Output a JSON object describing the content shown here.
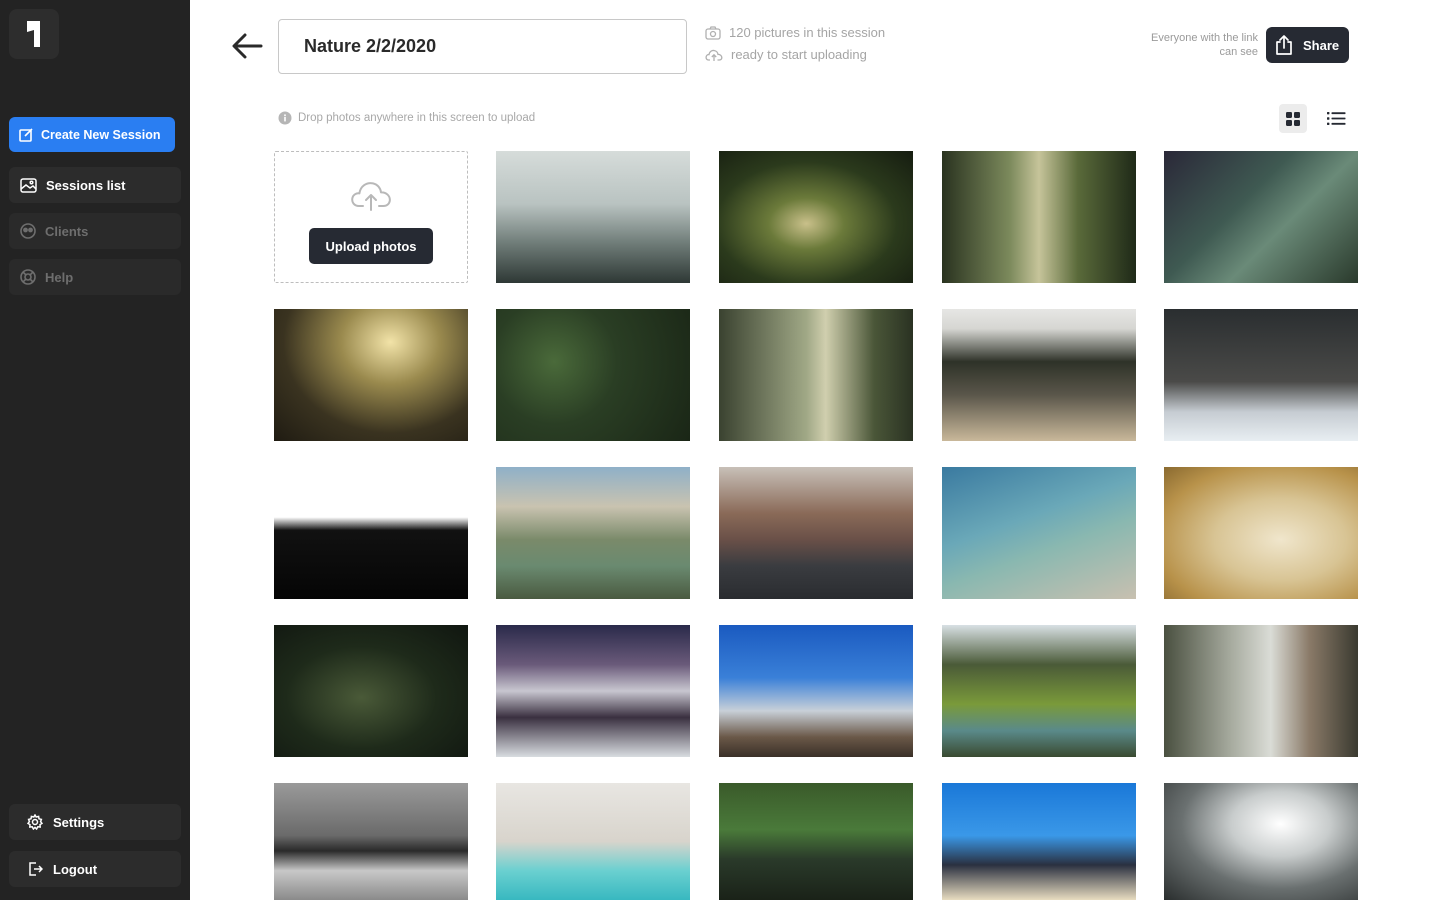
{
  "app": {
    "brand_colors": {
      "sidebar": "#232323",
      "primary": "#2a7ef2",
      "dark_button": "#262a33"
    }
  },
  "sidebar": {
    "logo_icon": "brand-logo-icon",
    "create_label": "Create New Session",
    "items": [
      {
        "label": "Sessions list",
        "icon": "photo-gallery-icon",
        "active": true
      },
      {
        "label": "Clients",
        "icon": "clients-icon",
        "active": false
      },
      {
        "label": "Help",
        "icon": "help-icon",
        "active": false
      }
    ],
    "bottom": [
      {
        "label": "Settings",
        "icon": "gear-icon"
      },
      {
        "label": "Logout",
        "icon": "logout-icon"
      }
    ]
  },
  "header": {
    "session_title": "Nature 2/2/2020",
    "picture_count": "120 pictures in this session",
    "upload_status": "ready to start uploading",
    "share_note": "Everyone with the link can see",
    "share_label": "Share"
  },
  "toolbar": {
    "drop_hint": "Drop photos anywhere in this screen to upload",
    "view_mode": "grid"
  },
  "gallery": {
    "upload_label": "Upload photos",
    "photos": [
      "misty-mountain-forest",
      "sunlit-forest-path",
      "misty-forest-sunbeams",
      "dark-pine-forest",
      "forest-sun-rays",
      "aerial-pine-canopy",
      "tall-forest-trunks",
      "foggy-treeline",
      "snowy-forest",
      "hill-silhouette",
      "bridge-over-river-city",
      "river-city-aerial",
      "rocky-coast-sea",
      "desert-dunes-person",
      "dark-jungle-path",
      "purple-snowy-mountain",
      "snow-capped-peak-blue-sky",
      "green-valley-lake",
      "foggy-tall-trees",
      "black-white-waves",
      "beach-swimmer-aerial",
      "forest-lake-reflection",
      "beach-seagulls-people",
      "waterfall-mist"
    ]
  }
}
